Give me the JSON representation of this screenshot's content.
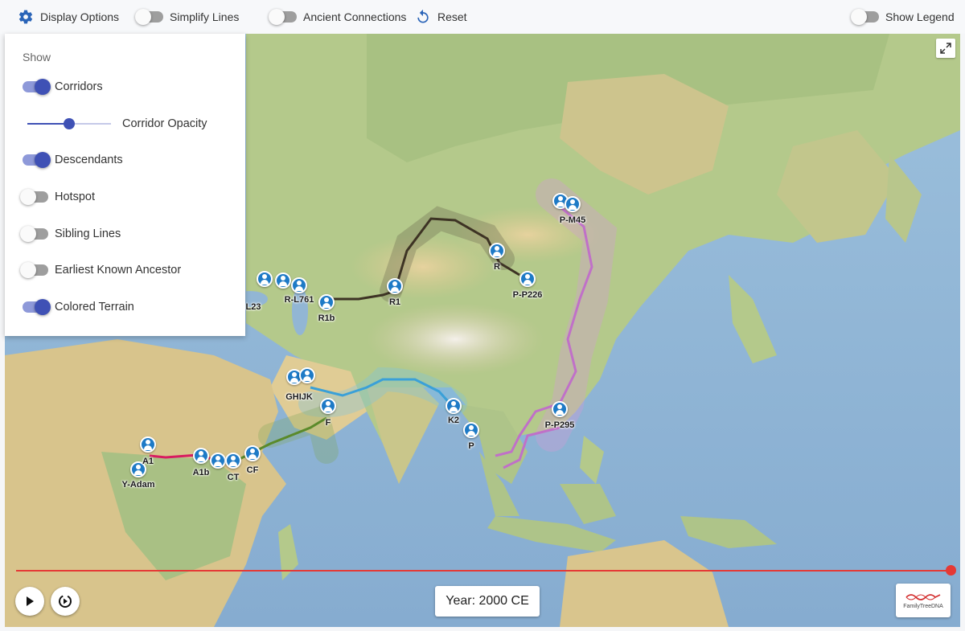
{
  "toolbar": {
    "display_options": "Display Options",
    "simplify_lines": "Simplify Lines",
    "simplify_lines_on": false,
    "ancient_connections": "Ancient Connections",
    "ancient_connections_on": false,
    "reset": "Reset",
    "show_legend": "Show Legend",
    "show_legend_on": false
  },
  "panel": {
    "title": "Show",
    "corridors": "Corridors",
    "corridors_on": true,
    "corridor_opacity": "Corridor Opacity",
    "corridor_opacity_value": 0.5,
    "descendants": "Descendants",
    "descendants_on": true,
    "hotspot": "Hotspot",
    "hotspot_on": false,
    "sibling_lines": "Sibling Lines",
    "sibling_lines_on": false,
    "earliest_known_ancestor": "Earliest Known Ancestor",
    "earliest_known_ancestor_on": false,
    "colored_terrain": "Colored Terrain",
    "colored_terrain_on": true
  },
  "markers": {
    "y_adam": "Y-Adam",
    "a1": "A1",
    "a1b": "A1b",
    "ct": "CT",
    "cf": "CF",
    "f": "F",
    "ghijk": "GHIJK",
    "l23": "L23",
    "r_l761": "R-L761",
    "r1b": "R1b",
    "r1": "R1",
    "r": "R",
    "p_p226": "P-P226",
    "p_m45": "P-M45",
    "k2": "K2",
    "p": "P",
    "p_p295": "P-P295"
  },
  "timeline": {
    "year": "Year: 2000 CE",
    "progress": 1.0
  },
  "logo": {
    "text": "FamilyTreeDNA"
  },
  "colors": {
    "accent": "#3f51b5",
    "timeline": "#e53935",
    "marker": "#1e7ac6",
    "route_black": "#3d3324",
    "route_blue": "#3aa0d8",
    "route_purple": "#c070c8",
    "route_pink": "#d81b60",
    "route_green": "#5a8a2a"
  }
}
